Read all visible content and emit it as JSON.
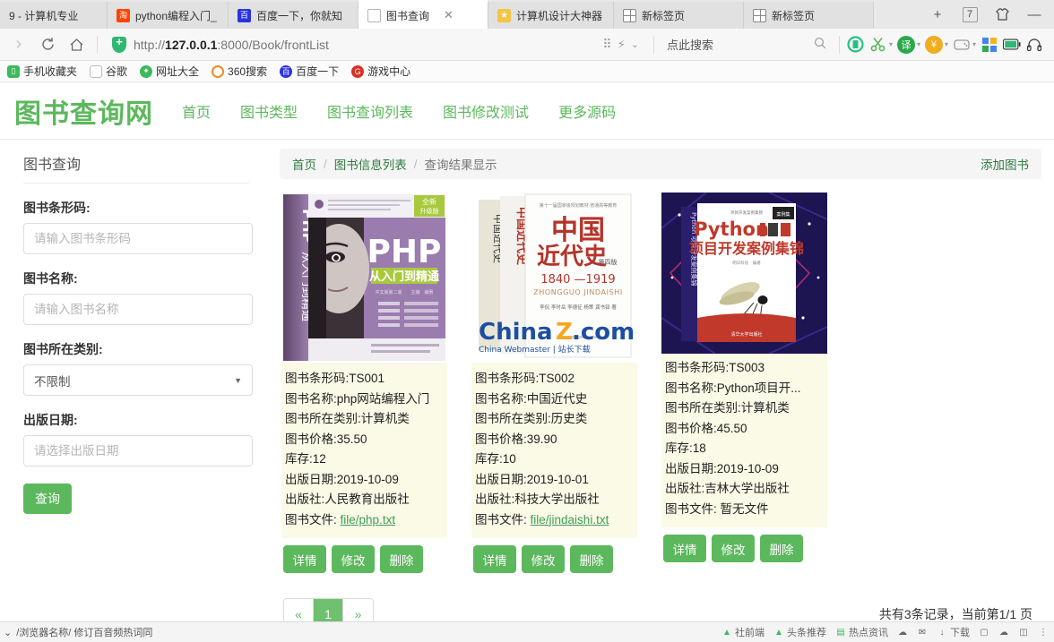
{
  "browser": {
    "tabs": [
      {
        "title": "9 - 计算机专业",
        "favicon": "none",
        "active": false
      },
      {
        "title": "python编程入门_",
        "favicon": "taobao-icon",
        "active": false
      },
      {
        "title": "百度一下，你就知",
        "favicon": "baidu-icon",
        "active": false
      },
      {
        "title": "图书查询",
        "favicon": "page-icon",
        "active": true
      },
      {
        "title": "计算机设计大神器",
        "favicon": "star-icon",
        "active": false
      },
      {
        "title": "新标签页",
        "favicon": "grid-icon",
        "active": false
      },
      {
        "title": "新标签页",
        "favicon": "grid-icon",
        "active": false
      }
    ],
    "tab_close_glyph": "✕",
    "new_tab_glyph": "+",
    "window_count": "7",
    "skin_glyph": "👕",
    "minimize_glyph": "—",
    "maximize_glyph": "☐",
    "close_glyph": "✕",
    "nav": {
      "back_glyph": "‹",
      "forward_glyph": "›",
      "reload_glyph": "⟳",
      "home_glyph": "⌂"
    },
    "url": {
      "prefix": "http://",
      "host": "127.0.0.1",
      "rest": ":8000/Book/frontList"
    },
    "url_tools": {
      "apps_glyph": "⠿",
      "lightning_glyph": "⚡",
      "chevron_glyph": "⌄"
    },
    "search_placeholder": "点此搜索",
    "search_icon": "search-icon",
    "extensions": [
      {
        "name": "browser-shield-icon",
        "glyph": "◯",
        "color": "#2eb872"
      },
      {
        "name": "scissors-icon",
        "glyph": "✂",
        "color": "#6ab150"
      },
      {
        "name": "translate-icon",
        "glyph": "译",
        "color": "#2ba84a"
      },
      {
        "name": "wallet-icon",
        "glyph": "¥",
        "color": "#f0ad20"
      },
      {
        "name": "game-icon",
        "glyph": "🎮",
        "color": "#999999"
      },
      {
        "name": "apps-grid-icon",
        "glyph": "▦",
        "color": "#3b78d8"
      },
      {
        "name": "battery-icon",
        "glyph": "▭",
        "color": "#333333"
      },
      {
        "name": "headphones-icon",
        "glyph": "∩",
        "color": "#333333"
      }
    ],
    "bookmarks": [
      {
        "label": "手机收藏夹",
        "icon": "phone-icon",
        "color": "#3dba5b"
      },
      {
        "label": "谷歌",
        "icon": "page-icon",
        "color": "#cccccc"
      },
      {
        "label": "网址大全",
        "icon": "plus-icon",
        "color": "#3dba5b"
      },
      {
        "label": "360搜索",
        "icon": "circle-icon",
        "color": "#f08a24"
      },
      {
        "label": "百度一下",
        "icon": "baidu-icon",
        "color": "#2932e1"
      },
      {
        "label": "游戏中心",
        "icon": "g-icon",
        "color": "#d93025"
      }
    ]
  },
  "site": {
    "brand": "图书查询网",
    "nav_items": [
      "首页",
      "图书类型",
      "图书查询列表",
      "图书修改测试",
      "更多源码"
    ],
    "accent_color": "#5cb85c"
  },
  "sidebar": {
    "title": "图书查询",
    "fields": [
      {
        "label": "图书条形码:",
        "placeholder": "请输入图书条形码",
        "value": "",
        "type": "text",
        "name": "barcode"
      },
      {
        "label": "图书名称:",
        "placeholder": "请输入图书名称",
        "value": "",
        "type": "text",
        "name": "bookname"
      },
      {
        "label": "图书所在类别:",
        "placeholder": "",
        "value": "不限制",
        "type": "select",
        "name": "category"
      },
      {
        "label": "出版日期:",
        "placeholder": "请选择出版日期",
        "value": "",
        "type": "text",
        "name": "pubdate"
      }
    ],
    "select_arrow": "▼",
    "query_button": "查询"
  },
  "breadcrumb": {
    "items": [
      "首页",
      "图书信息列表"
    ],
    "current": "查询结果显示",
    "separator": "/",
    "add_book": "添加图书"
  },
  "books": [
    {
      "barcode_label": "图书条形码:",
      "barcode": "TS001",
      "name_label": "图书名称:",
      "name": "php网站编程入门",
      "category_label": "图书所在类别:",
      "category": "计算机类",
      "price_label": "图书价格:",
      "price": "35.50",
      "stock_label": "库存:",
      "stock": "12",
      "date_label": "出版日期:",
      "date": "2019-10-09",
      "publisher_label": "出版社:",
      "publisher": "人民教育出版社",
      "file_label": "图书文件:",
      "file": "file/php.txt",
      "file_is_link": true,
      "cover": "php-book-cover",
      "buttons": [
        "详情",
        "修改",
        "删除"
      ]
    },
    {
      "barcode_label": "图书条形码:",
      "barcode": "TS002",
      "name_label": "图书名称:",
      "name": "中国近代史",
      "category_label": "图书所在类别:",
      "category": "历史类",
      "price_label": "图书价格:",
      "price": "39.90",
      "stock_label": "库存:",
      "stock": "10",
      "date_label": "出版日期:",
      "date": "2019-10-01",
      "publisher_label": "出版社:",
      "publisher": "科技大学出版社",
      "file_label": "图书文件:",
      "file": "file/jindaishi.txt",
      "file_is_link": true,
      "cover": "history-book-cover",
      "buttons": [
        "详情",
        "修改",
        "删除"
      ]
    },
    {
      "barcode_label": "图书条形码:",
      "barcode": "TS003",
      "name_label": "图书名称:",
      "name": "Python项目开...",
      "category_label": "图书所在类别:",
      "category": "计算机类",
      "price_label": "图书价格:",
      "price": "45.50",
      "stock_label": "库存:",
      "stock": "18",
      "date_label": "出版日期:",
      "date": "2019-10-09",
      "publisher_label": "出版社:",
      "publisher": "吉林大学出版社",
      "file_label": "图书文件:",
      "file": "暂无文件",
      "file_is_link": false,
      "cover": "python-book-cover",
      "buttons": [
        "详情",
        "修改",
        "删除"
      ]
    }
  ],
  "cover_text": {
    "php": {
      "title": "PHP",
      "subtitle": "从入门到精通",
      "badge": "全新\n升级版",
      "spine": "PHP 从入门到精通"
    },
    "history": {
      "title": "中国",
      "subtitle": "近代史",
      "years": "1840 —1919",
      "pinyin": "ZHONGGUO JINDAISHI",
      "spine": "中国近代史",
      "watermark": "China",
      "watermark2": "Z",
      "watermark3": ".com",
      "watermark_sub": "China Webmaster | 站长下载"
    },
    "python": {
      "title": "Python",
      "subtitle": "项目开发案例集锦"
    }
  },
  "pagination": {
    "prev": "«",
    "pages": [
      "1"
    ],
    "next": "»",
    "active_page": "1",
    "record_info": "共有3条记录，当前第1/1 页"
  },
  "taskbar": {
    "left_text": "/浏览器名称/ 修订百音频热词同",
    "items": [
      {
        "label": "社前端",
        "icon": "green-a-icon"
      },
      {
        "label": "头条推荐",
        "icon": "green-a-icon"
      },
      {
        "label": "热点资讯",
        "icon": "news-icon"
      },
      {
        "label": "",
        "icon": "weather-icon"
      },
      {
        "label": "",
        "icon": "mail-icon"
      },
      {
        "label": "下载",
        "icon": "download-icon"
      },
      {
        "label": "",
        "icon": "window-icon"
      },
      {
        "label": "",
        "icon": "cloud-icon"
      },
      {
        "label": "",
        "icon": "split-icon"
      },
      {
        "label": "",
        "icon": "more-icon"
      }
    ]
  }
}
